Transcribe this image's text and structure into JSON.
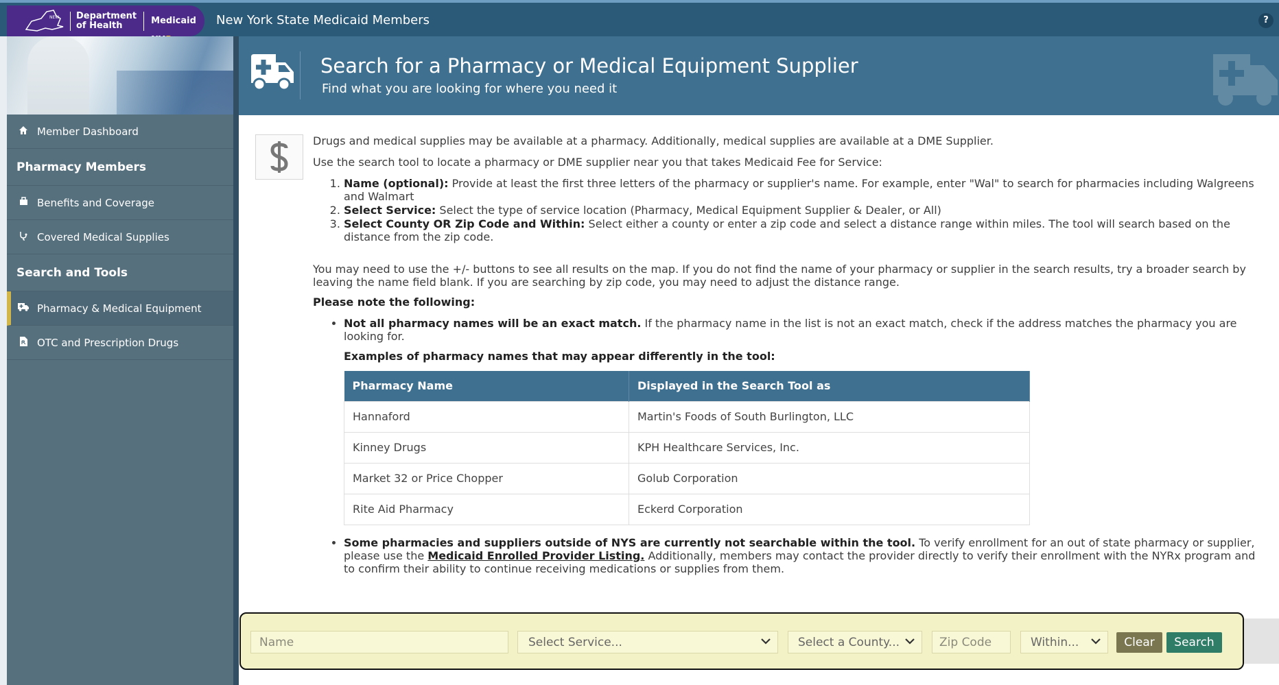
{
  "topbar": {
    "logo_state": "NEW YORK STATE",
    "logo_dept_line1": "Department",
    "logo_dept_line2": "of Health",
    "logo_medicaid": "Medicaid NY",
    "logo_rx": "Rx",
    "site_title": "New York State Medicaid Members",
    "help": "?"
  },
  "sidebar": {
    "dashboard": "Member Dashboard",
    "section1": "Pharmacy Members",
    "benefits": "Benefits and Coverage",
    "supplies": "Covered Medical Supplies",
    "section2": "Search and Tools",
    "pharmacy": "Pharmacy & Medical Equipment",
    "otc": "OTC and Prescription Drugs"
  },
  "header": {
    "title": "Search for a Pharmacy or Medical Equipment Supplier",
    "subtitle": "Find what you are looking for where you need it"
  },
  "content": {
    "intro1": "Drugs and medical supplies may be available at a pharmacy. Additionally, medical supplies are available at a DME Supplier.",
    "intro2": "Use the search tool to locate a pharmacy or DME supplier near you that takes Medicaid Fee for Service:",
    "step1_label": "Name (optional):",
    "step1_text": " Provide at least the first three letters of the pharmacy or supplier's name. For example, enter \"Wal\" to search for pharmacies including Walgreens and Walmart",
    "step2_label": "Select Service:",
    "step2_text": " Select the type of service location (Pharmacy, Medical Equipment Supplier & Dealer, or All)",
    "step3_label": "Select County OR Zip Code and Within:",
    "step3_text": " Select either a county or enter a zip code and select a distance range within miles. The tool will search based on the distance from the zip code.",
    "map_note": "You may need to use the +/- buttons to see all results on the map. If you do not find the name of your pharmacy or supplier in the search results, try a broader search by leaving the name field blank. If you are searching by zip code, you may need to adjust the distance range.",
    "note_heading": "Please note the following:",
    "bullet1_label": "Not all pharmacy names will be an exact match.",
    "bullet1_text": " If the pharmacy name in the list is not an exact match, check if the address matches the pharmacy you are looking for.",
    "examples_label": "Examples of pharmacy names that may appear differently in the tool:",
    "table_headers": [
      "Pharmacy Name",
      "Displayed in the Search Tool as"
    ],
    "table_rows": [
      [
        "Hannaford",
        "Martin's Foods of South Burlington, LLC"
      ],
      [
        "Kinney Drugs",
        "KPH Healthcare Services, Inc."
      ],
      [
        "Market 32 or Price Chopper",
        "Golub Corporation"
      ],
      [
        "Rite Aid Pharmacy",
        "Eckerd Corporation"
      ]
    ],
    "bullet2_label": "Some pharmacies and suppliers outside of NYS are currently not searchable within the tool.",
    "bullet2_text_a": " To verify enrollment for an out of state pharmacy or supplier, please use the ",
    "bullet2_link": "Medicaid Enrolled Provider Listing.",
    "bullet2_text_b": " Additionally, members may contact the provider directly to verify their enrollment with the NYRx program and to confirm their ability to continue receiving medications or supplies from them."
  },
  "search": {
    "name_placeholder": "Name",
    "service": "Select Service...",
    "county": "Select a County...",
    "zip_placeholder": "Zip Code",
    "within": "Within...",
    "clear": "Clear",
    "search": "Search"
  },
  "colors": {
    "topbar": "#2b5a79",
    "logo": "#4b2a89",
    "sidebar": "#57707e",
    "header": "#3f708f",
    "clear_button": "#7a7650",
    "search_button": "#2f7d67",
    "search_bar_bg": "#f3f2c7"
  }
}
